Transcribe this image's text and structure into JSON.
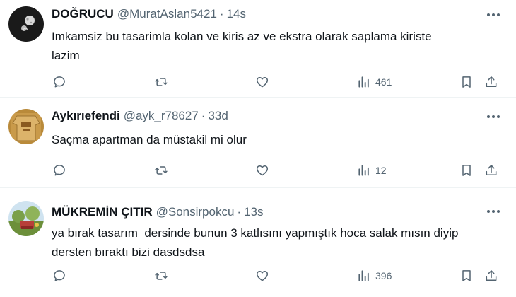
{
  "tweets": [
    {
      "name": "DOĞRUCU",
      "handle": "@MuratAslan5421",
      "separator": "·",
      "time": "14s",
      "text": "Imkamsiz bu tasarimla kolan ve kiris az ve ekstra olarak saplama kiriste\nlazim",
      "views": "461",
      "avatar_icon": "moon-planet-avatar"
    },
    {
      "name": "Aykırıefendi",
      "handle": "@ayk_r78627",
      "separator": "·",
      "time": "33d",
      "text": "Saçma apartman da müstakil mi olur",
      "views": "12",
      "avatar_icon": "shirt-avatar"
    },
    {
      "name": "MÜKREMİN ÇITIR",
      "handle": "@Sonsirpokcu",
      "separator": "·",
      "time": "13s",
      "text": "ya bırak tasarım  dersinde bunun 3 katlısını yapmıştık hoca salak mısın diyip\ndersten bıraktı bizi dasdsdsa",
      "views": "396",
      "avatar_icon": "garden-photo-avatar"
    }
  ],
  "colors": {
    "text": "#0f1419",
    "secondary": "#536471",
    "divider": "#eff3f4",
    "background": "#ffffff"
  }
}
